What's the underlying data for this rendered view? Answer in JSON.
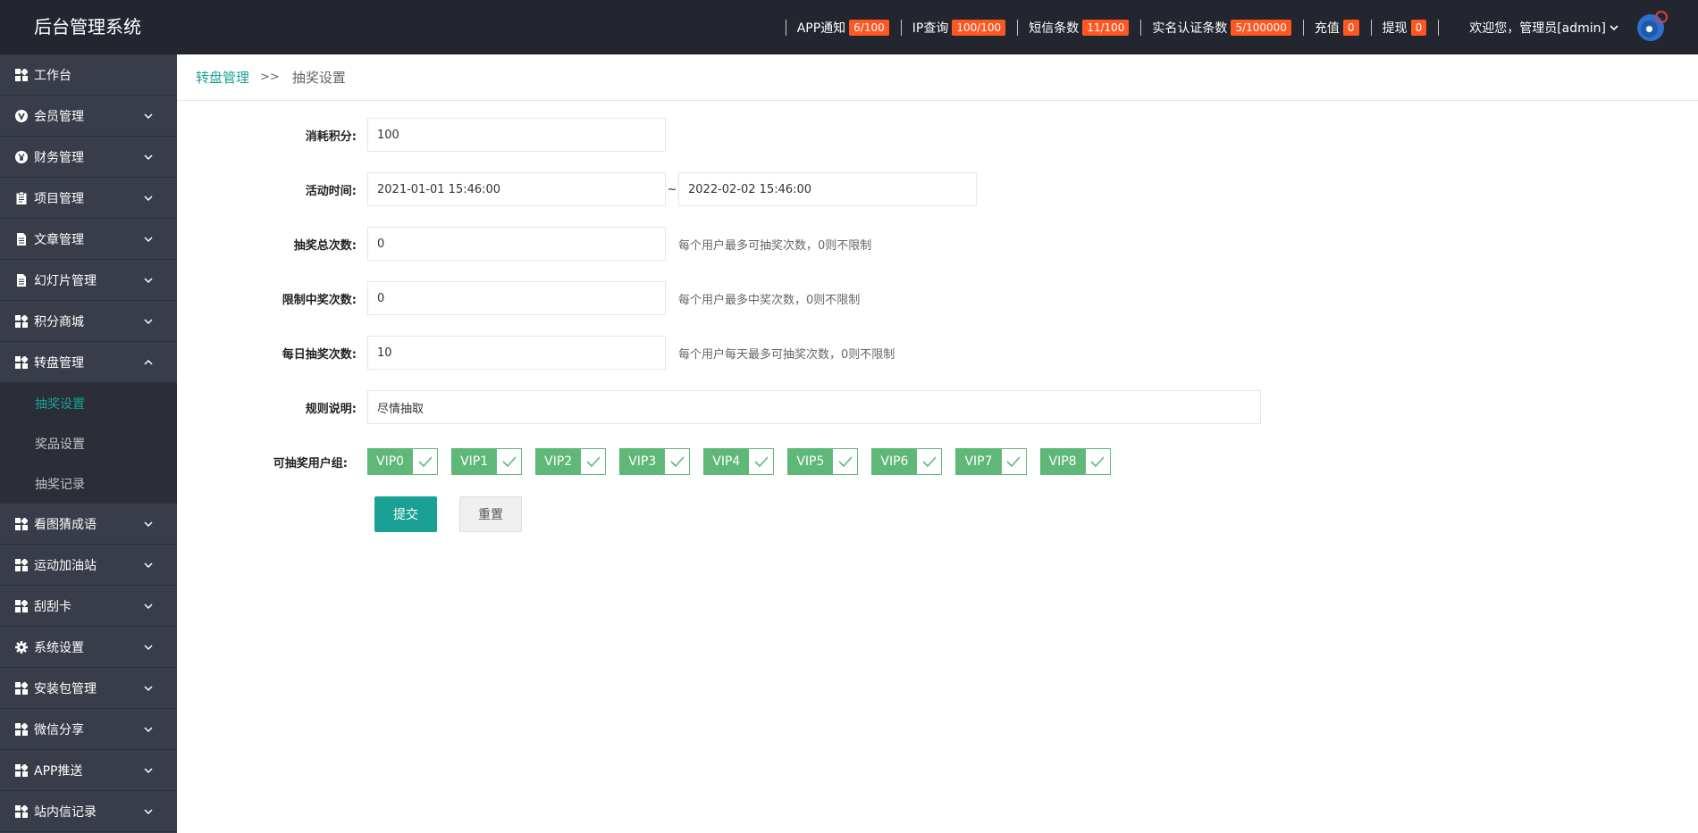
{
  "header": {
    "app_title": "后台管理系统",
    "stats": [
      {
        "label": "APP通知",
        "value": "6/100"
      },
      {
        "label": "IP查询",
        "value": "100/100"
      },
      {
        "label": "短信条数",
        "value": "11/100"
      },
      {
        "label": "实名认证条数",
        "value": "5/100000"
      },
      {
        "label": "充值",
        "value": "0"
      },
      {
        "label": "提现",
        "value": "0"
      }
    ],
    "welcome": "欢迎您，管理员[admin]",
    "badge_color": "#ff5722"
  },
  "sidebar": {
    "items": [
      {
        "label": "工作台",
        "icon": "dashboard-icon"
      },
      {
        "label": "会员管理",
        "icon": "v-circle-icon"
      },
      {
        "label": "财务管理",
        "icon": "yen-circle-icon"
      },
      {
        "label": "项目管理",
        "icon": "clipboard-icon"
      },
      {
        "label": "文章管理",
        "icon": "document-icon"
      },
      {
        "label": "幻灯片管理",
        "icon": "document-icon"
      },
      {
        "label": "积分商城",
        "icon": "grid-icon"
      },
      {
        "label": "转盘管理",
        "icon": "grid-icon"
      },
      {
        "label": "看图猜成语",
        "icon": "grid-icon"
      },
      {
        "label": "运动加油站",
        "icon": "grid-icon"
      },
      {
        "label": "刮刮卡",
        "icon": "grid-icon"
      },
      {
        "label": "系统设置",
        "icon": "gear-icon"
      },
      {
        "label": "安装包管理",
        "icon": "grid-icon"
      },
      {
        "label": "微信分享",
        "icon": "grid-icon"
      },
      {
        "label": "APP推送",
        "icon": "grid-icon"
      },
      {
        "label": "站内信记录",
        "icon": "grid-icon"
      }
    ],
    "submenu": [
      "抽奖设置",
      "奖品设置",
      "抽奖记录"
    ],
    "accent_color": "#1aa094"
  },
  "breadcrumb": {
    "parent": "转盘管理",
    "separator": ">>",
    "current": "抽奖设置"
  },
  "form": {
    "cost": {
      "label": "消耗积分:",
      "value": "100"
    },
    "time": {
      "label": "活动时间:",
      "start": "2021-01-01 15:46:00",
      "separator": "~",
      "end": "2022-02-02 15:46:00"
    },
    "total": {
      "label": "抽奖总次数:",
      "value": "0",
      "hint": "每个用户最多可抽奖次数，0则不限制"
    },
    "win_limit": {
      "label": "限制中奖次数:",
      "value": "0",
      "hint": "每个用户最多中奖次数，0则不限制"
    },
    "daily": {
      "label": "每日抽奖次数:",
      "value": "10",
      "hint": "每个用户每天最多可抽奖次数，0则不限制"
    },
    "rules": {
      "label": "规则说明:",
      "value": "尽情抽取"
    },
    "groups": {
      "label": "可抽奖用户组:",
      "items": [
        "VIP0",
        "VIP1",
        "VIP2",
        "VIP3",
        "VIP4",
        "VIP5",
        "VIP6",
        "VIP7",
        "VIP8"
      ],
      "checked": [
        true,
        true,
        true,
        true,
        true,
        true,
        true,
        true,
        true
      ]
    },
    "submit_label": "提交",
    "reset_label": "重置",
    "checkbox_color": "#5fb878"
  }
}
